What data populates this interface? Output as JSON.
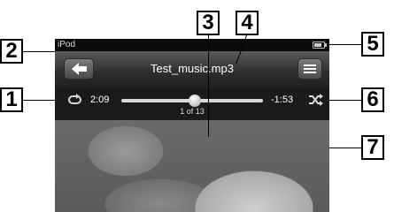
{
  "status_bar": {
    "carrier": "iPod"
  },
  "nav_bar": {
    "title": "Test_music.mp3",
    "back_icon": "back-arrow-icon",
    "list_icon": "list-icon"
  },
  "controls": {
    "elapsed": "2:09",
    "remaining": "-1:53",
    "track_count": "1 of 13",
    "progress_fraction": 0.52,
    "repeat_icon": "repeat-icon",
    "shuffle_icon": "shuffle-icon"
  },
  "callouts": [
    "1",
    "2",
    "3",
    "4",
    "5",
    "6",
    "7"
  ]
}
